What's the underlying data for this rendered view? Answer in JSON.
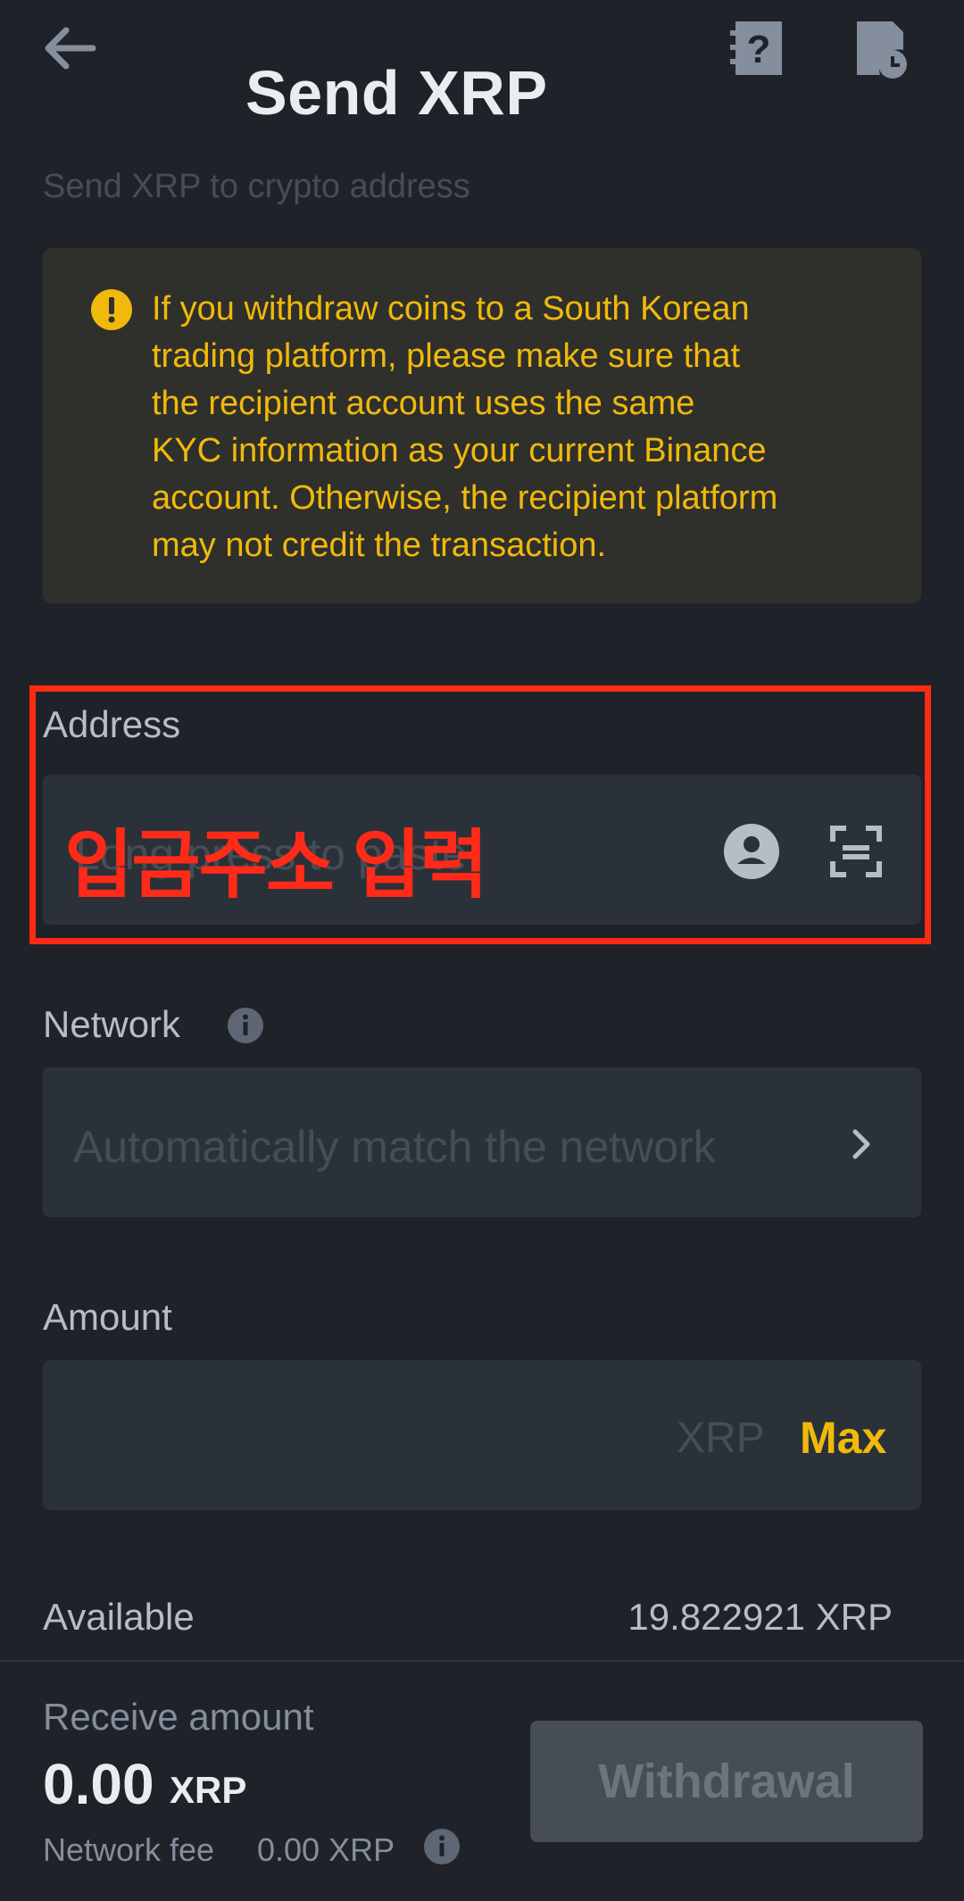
{
  "header": {
    "title": "Send XRP",
    "subtitle": "Send XRP to crypto address",
    "icons": [
      "back-arrow-icon",
      "help-document-icon",
      "history-clock-icon"
    ]
  },
  "warning": {
    "icon": "exclamation-circle-icon",
    "lines": [
      "If you withdraw coins to a South Korean",
      "trading platform, please make sure that",
      "the recipient account uses the same",
      "KYC information as your current Binance",
      "account. Otherwise, the recipient platform",
      "may not credit the transaction."
    ]
  },
  "address": {
    "label": "Address",
    "placeholder": "Long press to paste",
    "overlay_annotation": "입금주소 입력",
    "icons": [
      "contact-icon",
      "scan-qr-icon"
    ]
  },
  "network": {
    "label": "Network",
    "placeholder": "Automatically match the network",
    "icons": [
      "info-icon",
      "chevron-right-icon"
    ]
  },
  "amount": {
    "label": "Amount",
    "unit": "XRP",
    "max_label": "Max"
  },
  "available": {
    "label": "Available",
    "value": "19.822921 XRP"
  },
  "footer": {
    "receive_label": "Receive amount",
    "receive_value": "0.00",
    "receive_unit": "XRP",
    "fee_label": "Network fee",
    "fee_value": "0.00 XRP",
    "withdraw_label": "Withdrawal"
  },
  "colors": {
    "background": "#1f2329",
    "field": "#2b3139",
    "accent": "#f0b90b",
    "annotation_red": "#ff2a12"
  }
}
